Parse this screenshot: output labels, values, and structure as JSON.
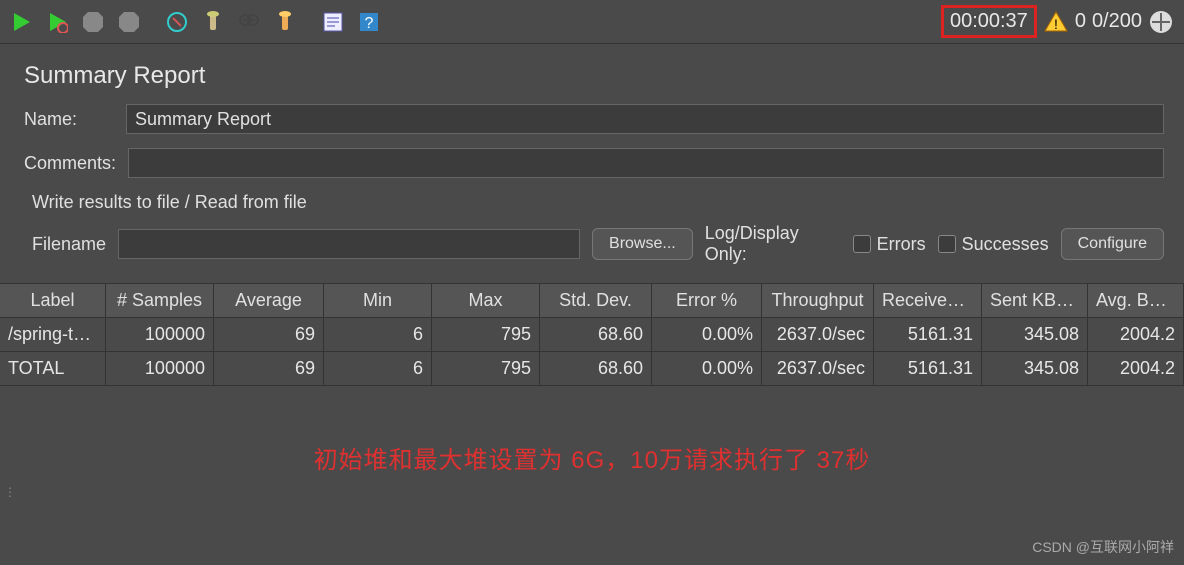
{
  "toolbar": {
    "timer": "00:00:37",
    "warn_count": "0",
    "run_count": "0/200"
  },
  "panel": {
    "title": "Summary Report",
    "name_label": "Name:",
    "name_value": "Summary Report",
    "comments_label": "Comments:",
    "comments_value": ""
  },
  "file": {
    "section_label": "Write results to file / Read from file",
    "filename_label": "Filename",
    "filename_value": "",
    "browse_btn": "Browse...",
    "logdisplay_label": "Log/Display Only:",
    "errors_label": "Errors",
    "successes_label": "Successes",
    "configure_btn": "Configure"
  },
  "table": {
    "headers": [
      "Label",
      "# Samples",
      "Average",
      "Min",
      "Max",
      "Std. Dev.",
      "Error %",
      "Throughput",
      "Received ...",
      "Sent KB/sec",
      "Avg. Bytes"
    ],
    "rows": [
      [
        "/spring-te...",
        "100000",
        "69",
        "6",
        "795",
        "68.60",
        "0.00%",
        "2637.0/sec",
        "5161.31",
        "345.08",
        "2004.2"
      ],
      [
        "TOTAL",
        "100000",
        "69",
        "6",
        "795",
        "68.60",
        "0.00%",
        "2637.0/sec",
        "5161.31",
        "345.08",
        "2004.2"
      ]
    ]
  },
  "annotation": "初始堆和最大堆设置为 6G，10万请求执行了 37秒",
  "watermark": "CSDN @互联网小阿祥"
}
